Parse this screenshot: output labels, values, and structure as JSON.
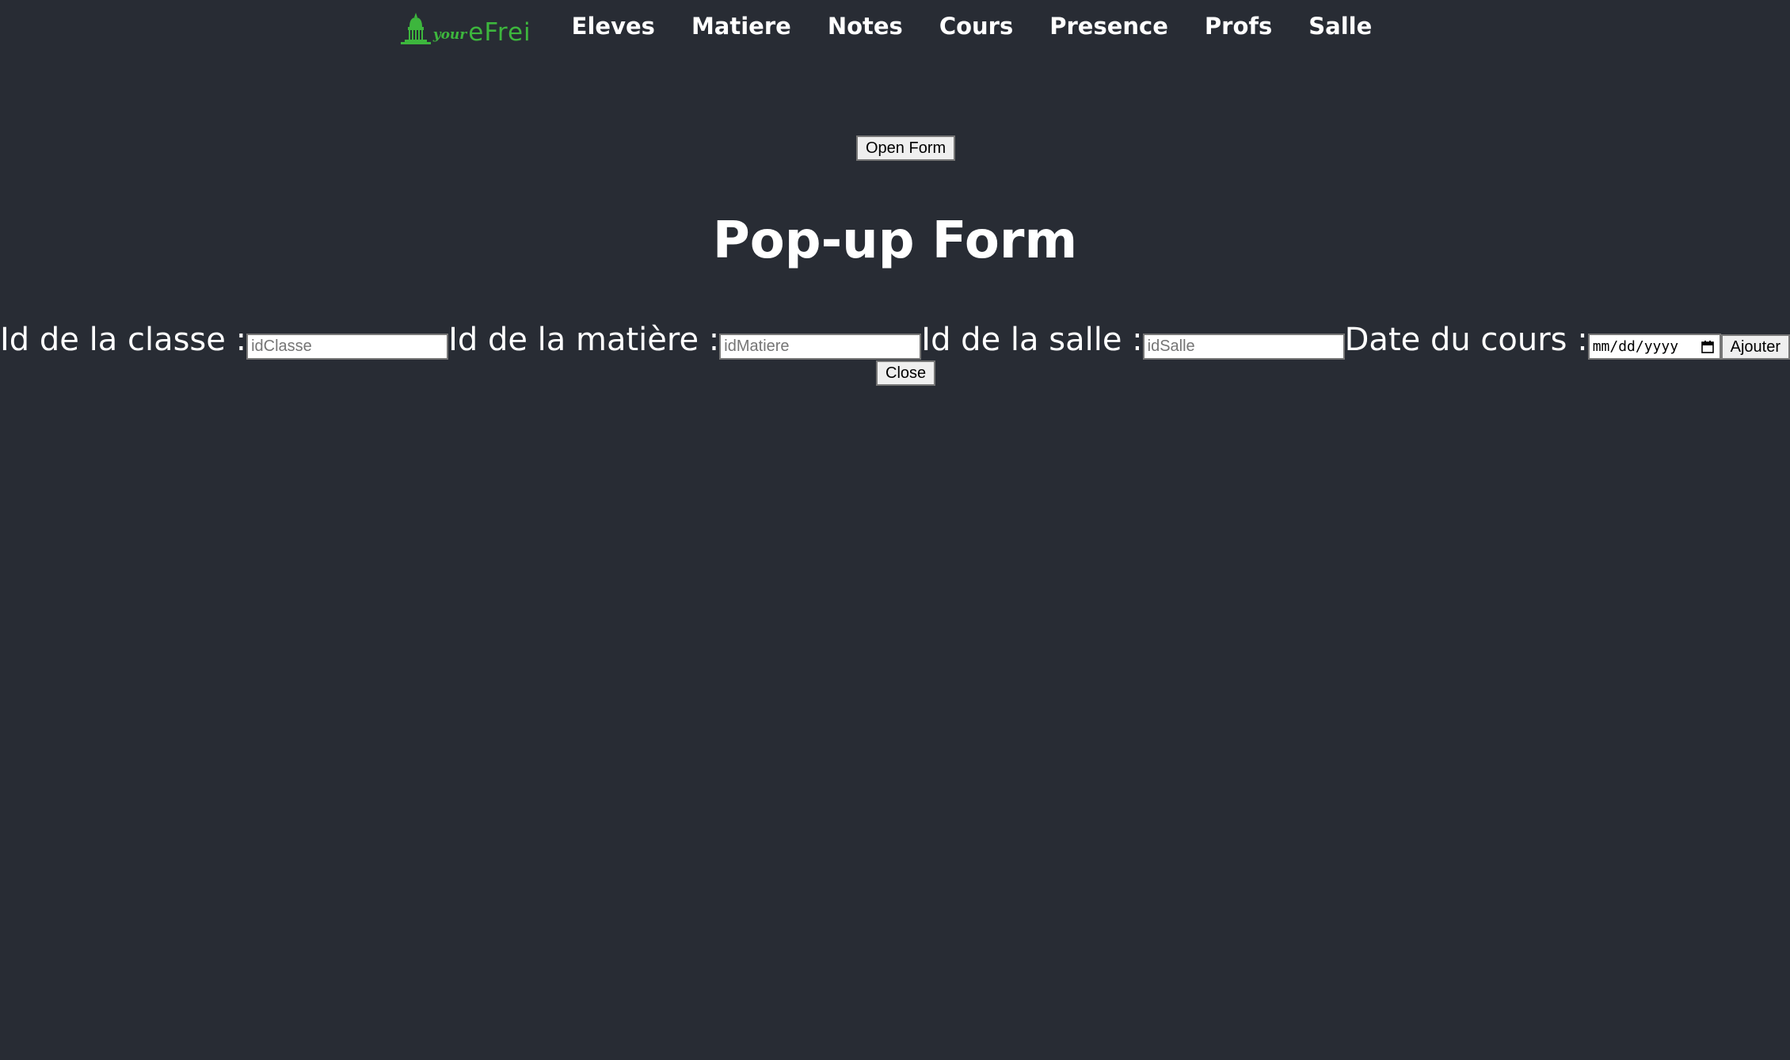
{
  "nav": {
    "logo": {
      "your": "your",
      "efrei": "eFrei",
      "color": "#3db63d"
    },
    "links": [
      "Eleves",
      "Matiere",
      "Notes",
      "Cours",
      "Presence",
      "Profs",
      "Salle"
    ]
  },
  "open_form_label": "Open Form",
  "popup": {
    "title": "Pop-up Form",
    "fields": {
      "classe": {
        "label": "Id de la classe :",
        "placeholder": "idClasse",
        "value": ""
      },
      "matiere": {
        "label": "Id de la matière :",
        "placeholder": "idMatiere",
        "value": ""
      },
      "salle": {
        "label": "Id de la salle :",
        "placeholder": "idSalle",
        "value": ""
      },
      "date": {
        "label": "Date du cours :",
        "placeholder": "mm/dd/yyyy",
        "icon": "calendar-icon"
      }
    },
    "submit_label": "Ajouter",
    "close_label": "Close"
  },
  "colors": {
    "background": "#282c34",
    "text": "#ffffff",
    "logo_green": "#3db63d"
  }
}
